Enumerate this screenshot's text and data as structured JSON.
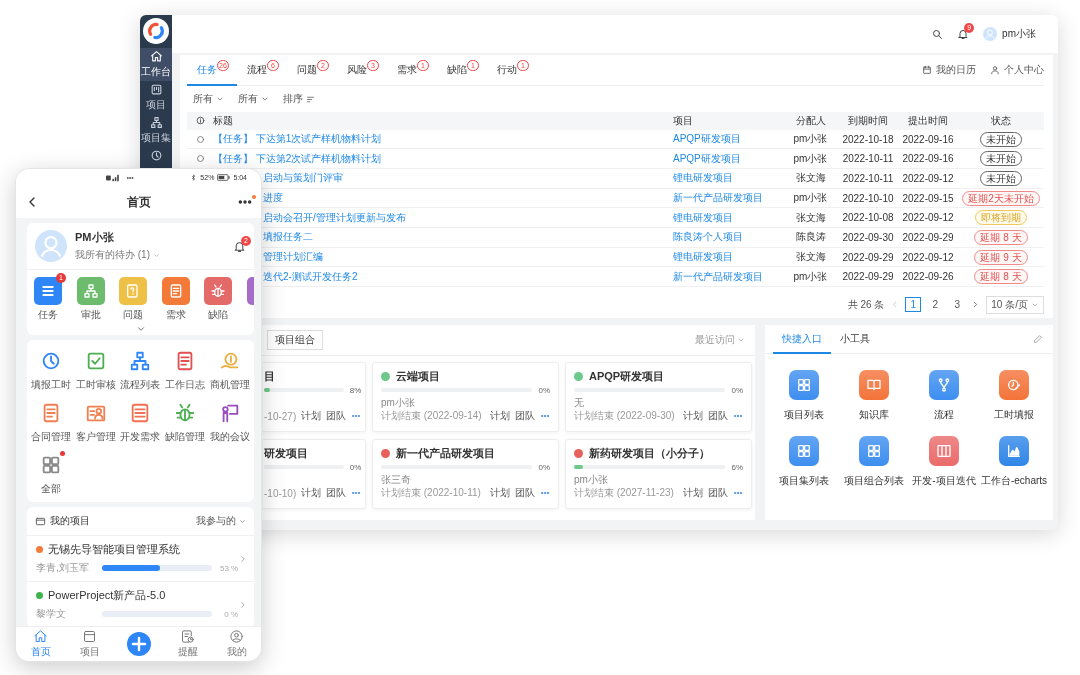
{
  "desktop": {
    "sidebar": [
      {
        "label": "工作台",
        "kind": "home",
        "selected": true
      },
      {
        "label": "项目",
        "kind": "project",
        "selected": false
      },
      {
        "label": "项目集",
        "kind": "set",
        "selected": false
      },
      {
        "kind": "gauge",
        "selected": false
      }
    ],
    "topbar": {
      "notifications": "9",
      "user": "pm小张"
    },
    "tabs": [
      {
        "label": "任务",
        "count": "26",
        "selected": true
      },
      {
        "label": "流程",
        "count": "6",
        "selected": false
      },
      {
        "label": "问题",
        "count": "2",
        "selected": false
      },
      {
        "label": "风险",
        "count": "3",
        "selected": false
      },
      {
        "label": "需求",
        "count": "1",
        "selected": false
      },
      {
        "label": "缺陷",
        "count": "1",
        "selected": false
      },
      {
        "label": "行动",
        "count": "1",
        "selected": false
      }
    ],
    "links": [
      {
        "label": "我的日历",
        "kind": "calendar"
      },
      {
        "label": "个人中心",
        "kind": "person"
      }
    ],
    "filters": [
      {
        "label": "所有",
        "kind": "dropdown"
      },
      {
        "label": "所有",
        "kind": "dropdown"
      },
      {
        "label": "排序",
        "kind": "sort"
      }
    ],
    "table": {
      "columns": [
        "标题",
        "项目",
        "分配人",
        "到期时间",
        "提出时间",
        "状态"
      ],
      "rows": [
        {
          "kind": "full",
          "title": "【任务】 下达第1次试产样机物料计划",
          "project": "APQP研发项目",
          "assignee": "pm小张",
          "due": "2022-10-18",
          "submitted": "2022-09-16",
          "status": {
            "label": "未开始",
            "kind": "not_started"
          }
        },
        {
          "kind": "full",
          "title": "【任务】 下达第2次试产样机物料计划",
          "project": "APQP研发项目",
          "assignee": "pm小张",
          "due": "2022-10-11",
          "submitted": "2022-09-16",
          "status": {
            "label": "未开始",
            "kind": "not_started"
          }
        },
        {
          "kind": "partial",
          "title": "启动与策划门评审",
          "project": "锂电研发项目",
          "assignee": "张文海",
          "due": "2022-10-11",
          "submitted": "2022-09-12",
          "status": {
            "label": "未开始",
            "kind": "not_started"
          }
        },
        {
          "kind": "partial",
          "title": "进度",
          "project": "新一代产品研发项目",
          "assignee": "pm小张",
          "due": "2022-10-10",
          "submitted": "2022-09-15",
          "status": {
            "label": "延期2天未开始",
            "kind": "overdue"
          }
        },
        {
          "kind": "partial",
          "title": "启动会召开/管理计划更新与发布",
          "project": "锂电研发项目",
          "assignee": "张文海",
          "due": "2022-10-08",
          "submitted": "2022-09-12",
          "status": {
            "label": "即将到期",
            "kind": "due_soon"
          }
        },
        {
          "kind": "partial",
          "title": "填报任务二",
          "project": "陈良涛个人项目",
          "assignee": "陈良涛",
          "due": "2022-09-30",
          "submitted": "2022-09-29",
          "status": {
            "label": "延期 8 天",
            "kind": "overdue"
          }
        },
        {
          "kind": "partial",
          "title": "管理计划汇编",
          "project": "锂电研发项目",
          "assignee": "张文海",
          "due": "2022-09-29",
          "submitted": "2022-09-12",
          "status": {
            "label": "延期 9 天",
            "kind": "overdue"
          }
        },
        {
          "kind": "partial",
          "title": "迭代2-测试开发任务2",
          "project": "新一代产品研发项目",
          "assignee": "pm小张",
          "due": "2022-09-29",
          "submitted": "2022-09-26",
          "status": {
            "label": "延期 8 天",
            "kind": "overdue"
          }
        }
      ]
    },
    "pagination": {
      "total": "共 26 条",
      "pages": [
        {
          "label": "1",
          "selected": true
        },
        {
          "label": "2",
          "selected": false
        },
        {
          "label": "3",
          "selected": false
        }
      ],
      "page_size": "10 条/页"
    },
    "projects": {
      "button": "项目组合",
      "sort": "最近访问",
      "cards": [
        {
          "kind": "partial",
          "title": "目",
          "level": 0.08,
          "percent": "8%",
          "date": "-10-27)",
          "actions": [
            "计划",
            "团队"
          ]
        },
        {
          "kind": "full",
          "title": "云端项目",
          "color": "#6cc98a",
          "level": 0,
          "percent": "0%",
          "owner": "pm小张",
          "date": "计划结束 (2022-09-14)",
          "actions": [
            "计划",
            "团队"
          ]
        },
        {
          "kind": "full",
          "title": "APQP研发项目",
          "color": "#6cc98a",
          "level": 0,
          "percent": "0%",
          "owner": "无",
          "date": "计划结束 (2022-09-30)",
          "actions": [
            "计划",
            "团队"
          ]
        },
        {
          "kind": "partial",
          "title": "研发项目",
          "level": 0,
          "percent": "0%",
          "date": "-10-10)",
          "actions": [
            "计划",
            "团队"
          ]
        },
        {
          "kind": "full",
          "title": "新一代产品研发项目",
          "color": "#e8605c",
          "level": 0,
          "percent": "0%",
          "owner": "张三奇",
          "date": "计划结束 (2022-10-11)",
          "actions": [
            "计划",
            "团队"
          ]
        },
        {
          "kind": "full",
          "title": "新药研发项目（小分子）",
          "color": "#e8605c",
          "level": 0.06,
          "percent": "6%",
          "owner": "pm小张",
          "date": "计划结束 (2027-11-23)",
          "actions": [
            "计划",
            "团队"
          ]
        }
      ]
    },
    "quick": {
      "tabs": [
        {
          "label": "快捷入口",
          "selected": true
        },
        {
          "label": "小工具",
          "selected": false
        }
      ],
      "items": [
        {
          "label": "项目列表",
          "kind": "grid",
          "color": "#3d8ef0"
        },
        {
          "label": "知识库",
          "kind": "book",
          "color": "#f4733a"
        },
        {
          "label": "流程",
          "kind": "branch",
          "color": "#3d8ef0"
        },
        {
          "label": "工时填报",
          "kind": "clock",
          "color": "#f4733a"
        },
        {
          "label": "项目集列表",
          "kind": "grid",
          "color": "#3d8ef0"
        },
        {
          "label": "项目组合列表",
          "kind": "grid",
          "color": "#3d8ef0"
        },
        {
          "label": "开发-项目迭代",
          "kind": "columns",
          "color": "#ea6b6b"
        },
        {
          "label": "工作台-echarts",
          "kind": "chart",
          "color": "#2f86e8"
        }
      ]
    }
  },
  "phone": {
    "status_bar": {
      "battery": "52%",
      "time": "5:04"
    },
    "header": {
      "title": "首页",
      "more_unread": true
    },
    "user": {
      "name": "PM小张",
      "todo": "我所有的待办 (1)",
      "notifications": "2"
    },
    "apps": [
      {
        "label": "任务",
        "kind": "task",
        "color": "#2f86f6",
        "badge": "1"
      },
      {
        "label": "审批",
        "kind": "approve",
        "color": "#6dbb6d"
      },
      {
        "label": "问题",
        "kind": "question",
        "color": "#efc046"
      },
      {
        "label": "需求",
        "kind": "demand",
        "color": "#f47a3a"
      },
      {
        "label": "缺陷",
        "kind": "bug",
        "color": "#e46a6a"
      },
      {
        "kind": "blank",
        "color": "#a56cc9"
      }
    ],
    "tools": [
      {
        "label": "填报工时",
        "kind": "timer",
        "color": "#2f86f6",
        "unread": false
      },
      {
        "label": "工时审核",
        "kind": "check",
        "color": "#4caf50",
        "unread": false
      },
      {
        "label": "流程列表",
        "kind": "flow",
        "color": "#2f86f6",
        "unread": false
      },
      {
        "label": "工作日志",
        "kind": "log",
        "color": "#e05050",
        "unread": false
      },
      {
        "label": "商机管理",
        "kind": "coin",
        "color": "#e8b040",
        "unread": false
      },
      {
        "label": "合同管理",
        "kind": "contract",
        "color": "#f08050",
        "unread": false
      },
      {
        "label": "客户管理",
        "kind": "customer",
        "color": "#f08050",
        "unread": false
      },
      {
        "label": "开发需求",
        "kind": "form",
        "color": "#f07050",
        "unread": false
      },
      {
        "label": "缺陷管理",
        "kind": "bug",
        "color": "#4caf50",
        "unread": false
      },
      {
        "label": "我的会议",
        "kind": "meeting",
        "color": "#9a4cc0",
        "unread": false
      },
      {
        "label": "全部",
        "kind": "all",
        "color": "#8a8a8a",
        "unread": true
      }
    ],
    "my_projects": {
      "title": "我的项目",
      "filter": "我参与的",
      "items": [
        {
          "name": "无锡先导智能项目管理系统",
          "color": "#f47a3a",
          "members": "李青,刘玉军",
          "level": 0.53,
          "percent": "53 %"
        },
        {
          "name": "PowerProject新产品-5.0",
          "color": "#3cb44b",
          "members": "黎学文",
          "level": 0,
          "percent": "0 %"
        }
      ]
    },
    "nav": [
      {
        "label": "首页",
        "kind": "home",
        "selected": true
      },
      {
        "label": "项目",
        "kind": "project",
        "selected": false
      },
      {
        "kind": "add",
        "selected": false
      },
      {
        "label": "提醒",
        "kind": "remind",
        "selected": false
      },
      {
        "label": "我的",
        "kind": "me",
        "selected": false
      }
    ]
  }
}
